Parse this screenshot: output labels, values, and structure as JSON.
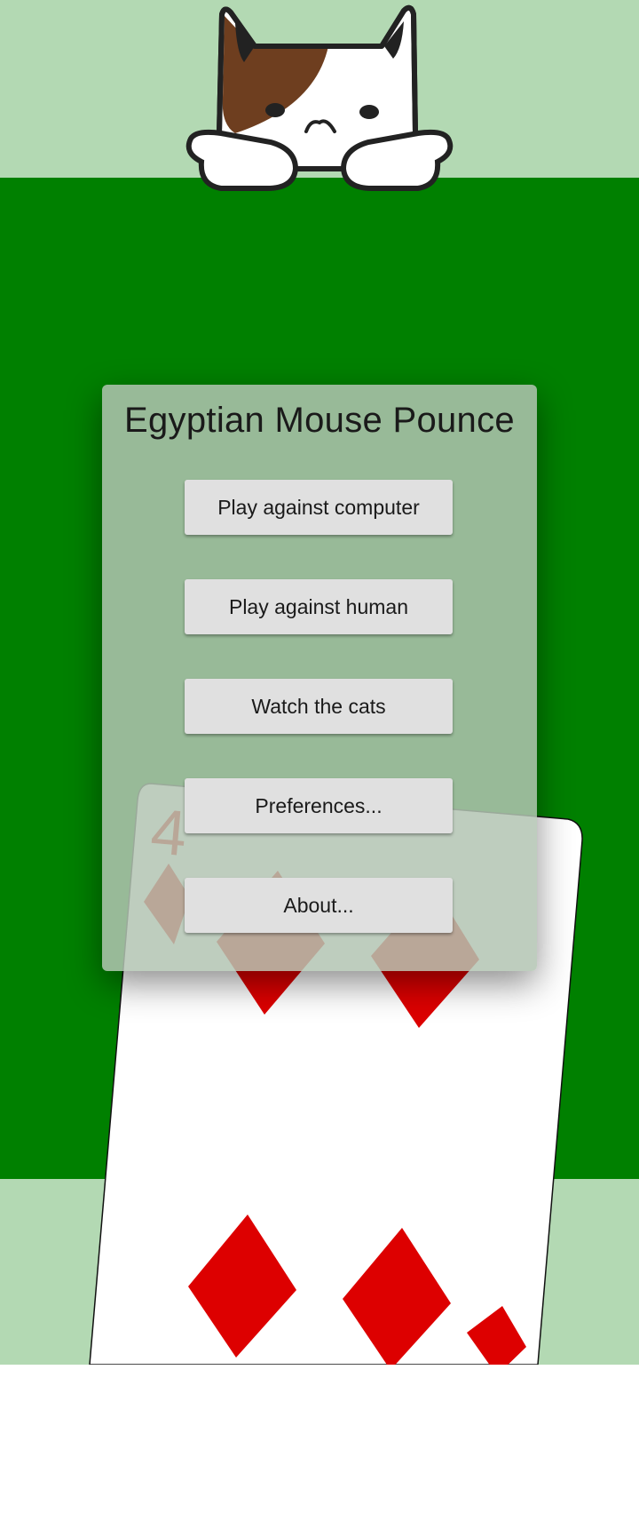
{
  "menu": {
    "title": "Egyptian Mouse Pounce",
    "buttons": [
      "Play against computer",
      "Play against human",
      "Watch the cats",
      "Preferences...",
      "About..."
    ]
  },
  "card": {
    "rank": "4",
    "suit": "diamond-icon",
    "suit_color": "#dd0000"
  },
  "colors": {
    "felt": "#008000",
    "band": "#b3d9b3",
    "cat_brown": "#6e3e1f"
  },
  "icons": {
    "mascot": "calico-cat-icon"
  }
}
